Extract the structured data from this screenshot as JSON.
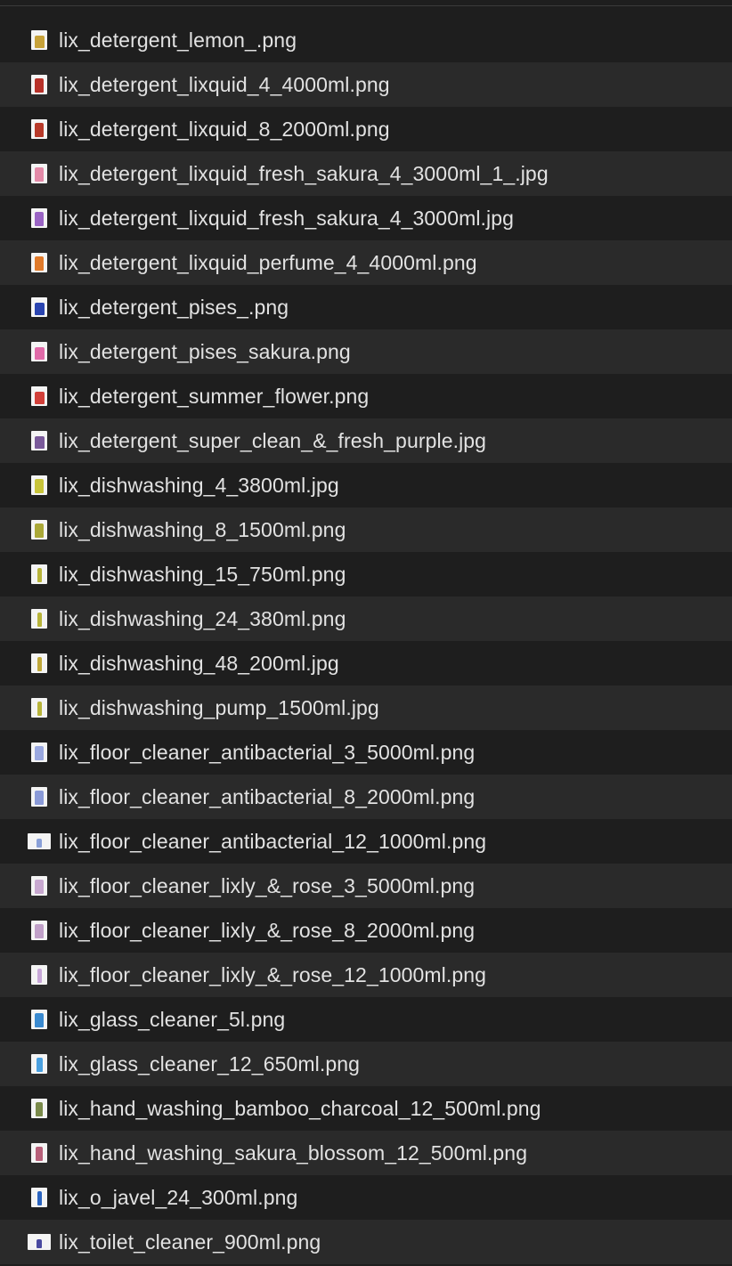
{
  "files": [
    {
      "name": "lix_detergent_lemon_.png",
      "icon": "detergent-box-thumbnail-icon",
      "color": "#c7a23a",
      "shape": "box"
    },
    {
      "name": "lix_detergent_lixquid_4_4000ml.png",
      "icon": "detergent-bottle-thumbnail-icon",
      "color": "#b8322a",
      "shape": "jug"
    },
    {
      "name": "lix_detergent_lixquid_8_2000ml.png",
      "icon": "detergent-bottle-thumbnail-icon",
      "color": "#b83a2a",
      "shape": "jug"
    },
    {
      "name": "lix_detergent_lixquid_fresh_sakura_4_3000ml_1_.jpg",
      "icon": "detergent-bottle-thumbnail-icon",
      "color": "#e48aa8",
      "shape": "jug"
    },
    {
      "name": "lix_detergent_lixquid_fresh_sakura_4_3000ml.jpg",
      "icon": "detergent-bottle-thumbnail-icon",
      "color": "#9a64c4",
      "shape": "jug"
    },
    {
      "name": "lix_detergent_lixquid_perfume_4_4000ml.png",
      "icon": "detergent-bottle-thumbnail-icon",
      "color": "#e07a2a",
      "shape": "jug"
    },
    {
      "name": "lix_detergent_pises_.png",
      "icon": "detergent-box-thumbnail-icon",
      "color": "#2a44b0",
      "shape": "box"
    },
    {
      "name": "lix_detergent_pises_sakura.png",
      "icon": "detergent-box-thumbnail-icon",
      "color": "#e06aa8",
      "shape": "box"
    },
    {
      "name": "lix_detergent_summer_flower.png",
      "icon": "detergent-box-thumbnail-icon",
      "color": "#d2403a",
      "shape": "box"
    },
    {
      "name": "lix_detergent_super_clean_&_fresh_purple.jpg",
      "icon": "detergent-bag-thumbnail-icon",
      "color": "#7a5a9a",
      "shape": "box"
    },
    {
      "name": "lix_dishwashing_4_3800ml.jpg",
      "icon": "dishwashing-jug-thumbnail-icon",
      "color": "#c8c43a",
      "shape": "jug"
    },
    {
      "name": "lix_dishwashing_8_1500ml.png",
      "icon": "dishwashing-jug-thumbnail-icon",
      "color": "#aaa838",
      "shape": "jug"
    },
    {
      "name": "lix_dishwashing_15_750ml.png",
      "icon": "dishwashing-bottle-thumbnail-icon",
      "color": "#b8b43a",
      "shape": "slim"
    },
    {
      "name": "lix_dishwashing_24_380ml.png",
      "icon": "dishwashing-bottle-thumbnail-icon",
      "color": "#b8b43a",
      "shape": "slim"
    },
    {
      "name": "lix_dishwashing_48_200ml.jpg",
      "icon": "dishwashing-bottle-thumbnail-icon",
      "color": "#c0a83a",
      "shape": "slim"
    },
    {
      "name": "lix_dishwashing_pump_1500ml.jpg",
      "icon": "dishwashing-pump-thumbnail-icon",
      "color": "#b8b43a",
      "shape": "slim"
    },
    {
      "name": "lix_floor_cleaner_antibacterial_3_5000ml.png",
      "icon": "floor-cleaner-thumbnail-icon",
      "color": "#9aa8e0",
      "shape": "jug"
    },
    {
      "name": "lix_floor_cleaner_antibacterial_8_2000ml.png",
      "icon": "floor-cleaner-thumbnail-icon",
      "color": "#8a9ad8",
      "shape": "jug"
    },
    {
      "name": "lix_floor_cleaner_antibacterial_12_1000ml.png",
      "icon": "floor-cleaner-thumbnail-icon",
      "color": "#8aa0d8",
      "shape": "landscape"
    },
    {
      "name": "lix_floor_cleaner_lixly_&_rose_3_5000ml.png",
      "icon": "floor-cleaner-thumbnail-icon",
      "color": "#c8a8d0",
      "shape": "jug"
    },
    {
      "name": "lix_floor_cleaner_lixly_&_rose_8_2000ml.png",
      "icon": "floor-cleaner-thumbnail-icon",
      "color": "#c0a0c8",
      "shape": "jug"
    },
    {
      "name": "lix_floor_cleaner_lixly_&_rose_12_1000ml.png",
      "icon": "floor-cleaner-thumbnail-icon",
      "color": "#c8a8d8",
      "shape": "slim"
    },
    {
      "name": "lix_glass_cleaner_5l.png",
      "icon": "glass-cleaner-thumbnail-icon",
      "color": "#3a8ad0",
      "shape": "jug"
    },
    {
      "name": "lix_glass_cleaner_12_650ml.png",
      "icon": "glass-cleaner-thumbnail-icon",
      "color": "#4aa0e0",
      "shape": "spray"
    },
    {
      "name": "lix_hand_washing_bamboo_charcoal_12_500ml.png",
      "icon": "hand-wash-thumbnail-icon",
      "color": "#7a8a4a",
      "shape": "pump"
    },
    {
      "name": "lix_hand_washing_sakura_blossom_12_500ml.png",
      "icon": "hand-wash-thumbnail-icon",
      "color": "#b8607a",
      "shape": "pump"
    },
    {
      "name": "lix_o_javel_24_300ml.png",
      "icon": "bleach-bottle-thumbnail-icon",
      "color": "#2a64c0",
      "shape": "slim"
    },
    {
      "name": "lix_toilet_cleaner_900ml.png",
      "icon": "toilet-cleaner-thumbnail-icon",
      "color": "#4a4aa0",
      "shape": "landscape"
    }
  ]
}
